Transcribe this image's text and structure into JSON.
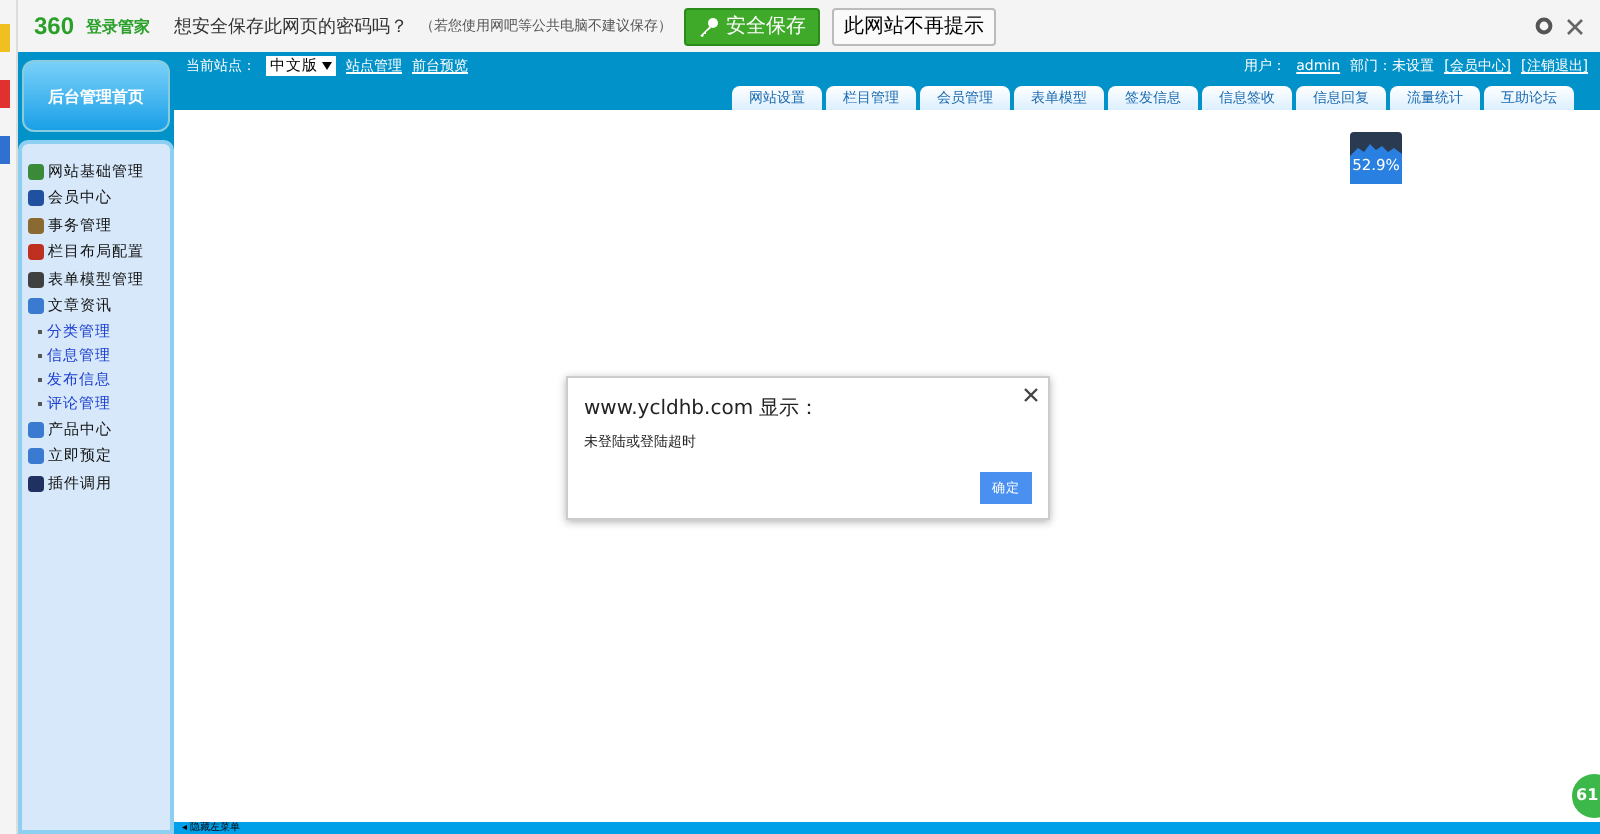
{
  "password_bar": {
    "brand": "360",
    "brand_sub": "登录管家",
    "question": "想安全保存此网页的密码吗？",
    "note": "（若您使用网吧等公共电脑不建议保存）",
    "save_button": "安全保存",
    "never_button": "此网站不再提示"
  },
  "header": {
    "site_label": "当前站点：",
    "site_select": "中文版",
    "links": [
      "站点管理",
      "前台预览"
    ],
    "user_label": "用户：",
    "user": "admin",
    "dept": "部门：未设置",
    "member_center": "[会员中心]",
    "logout": "[注销退出]",
    "tabs": [
      {
        "label": "网站设置",
        "selected": false
      },
      {
        "label": "栏目管理",
        "selected": false
      },
      {
        "label": "会员管理",
        "selected": false
      },
      {
        "label": "表单模型",
        "selected": false
      },
      {
        "label": "签发信息",
        "selected": false
      },
      {
        "label": "信息签收",
        "selected": false
      },
      {
        "label": "信息回复",
        "selected": false
      },
      {
        "label": "流量统计",
        "selected": false
      },
      {
        "label": "互助论坛",
        "selected": false
      }
    ]
  },
  "sidebar": {
    "home_button": "后台管理首页",
    "items": [
      {
        "label": "网站基础管理"
      },
      {
        "label": "会员中心"
      },
      {
        "label": "事务管理"
      },
      {
        "label": "栏目布局配置"
      },
      {
        "label": "表单模型管理"
      },
      {
        "label": "文章资讯",
        "children": [
          {
            "label": "分类管理"
          },
          {
            "label": "信息管理"
          },
          {
            "label": "发布信息"
          },
          {
            "label": "评论管理"
          }
        ]
      },
      {
        "label": "产品中心"
      },
      {
        "label": "立即预定"
      },
      {
        "label": "插件调用"
      }
    ]
  },
  "meter": {
    "reading": "52.9%"
  },
  "dialog": {
    "title": "www.ycldhb.com 显示：",
    "message": "未登陆或登陆超时",
    "ok_button": "确定"
  },
  "badge": "61",
  "bottom_bar": "◂ 隐藏左菜单"
}
